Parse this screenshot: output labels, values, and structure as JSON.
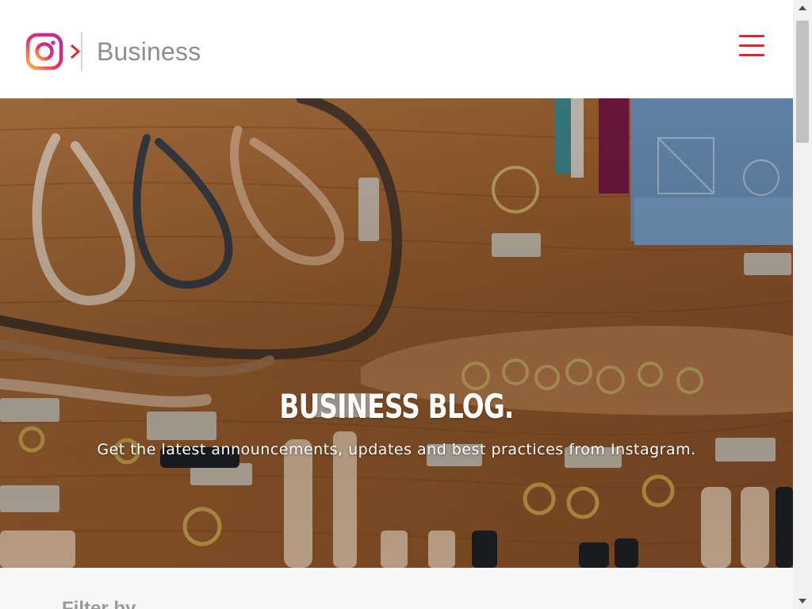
{
  "header": {
    "brand_label": "Business",
    "logo_icon": "instagram-logo-icon",
    "chevron_icon": "chevron-right-icon",
    "menu_icon": "hamburger-menu-icon"
  },
  "hero": {
    "title": "BUSINESS BLOG.",
    "subtitle": "Get the latest announcements, updates and best practices from Instagram."
  },
  "filter": {
    "label": "Filter by"
  },
  "colors": {
    "accent": "#e4262f",
    "brand_text": "#8e8e8e",
    "hero_wood": "#a8693a"
  }
}
